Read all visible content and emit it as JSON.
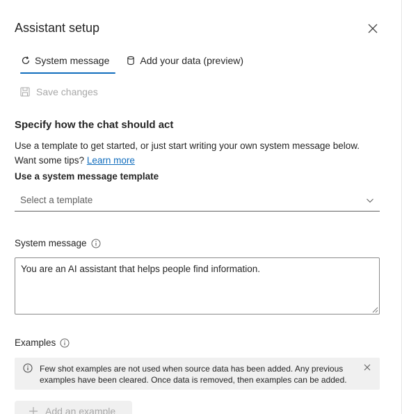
{
  "header": {
    "title": "Assistant setup"
  },
  "tabs": [
    {
      "label": "System message",
      "icon": "refresh-icon"
    },
    {
      "label": "Add your data (preview)",
      "icon": "database-icon"
    }
  ],
  "toolbar": {
    "save_label": "Save changes"
  },
  "section": {
    "title": "Specify how the chat should act",
    "description": "Use a template to get started, or just start writing your own system message below. Want some tips?",
    "learn_more": "Learn more"
  },
  "template": {
    "label": "Use a system message template",
    "placeholder": "Select a template"
  },
  "system_message": {
    "label": "System message",
    "value": "You are an AI assistant that helps people find information."
  },
  "examples": {
    "label": "Examples",
    "notice": "Few shot examples are not used when source data has been added. Any previous examples have been cleared. Once data is removed, then examples can be added.",
    "add_label": "Add an example"
  },
  "colors": {
    "accent": "#0f6cbd",
    "muted": "#a8a8a8",
    "notice_bg": "#f0f0f0"
  }
}
